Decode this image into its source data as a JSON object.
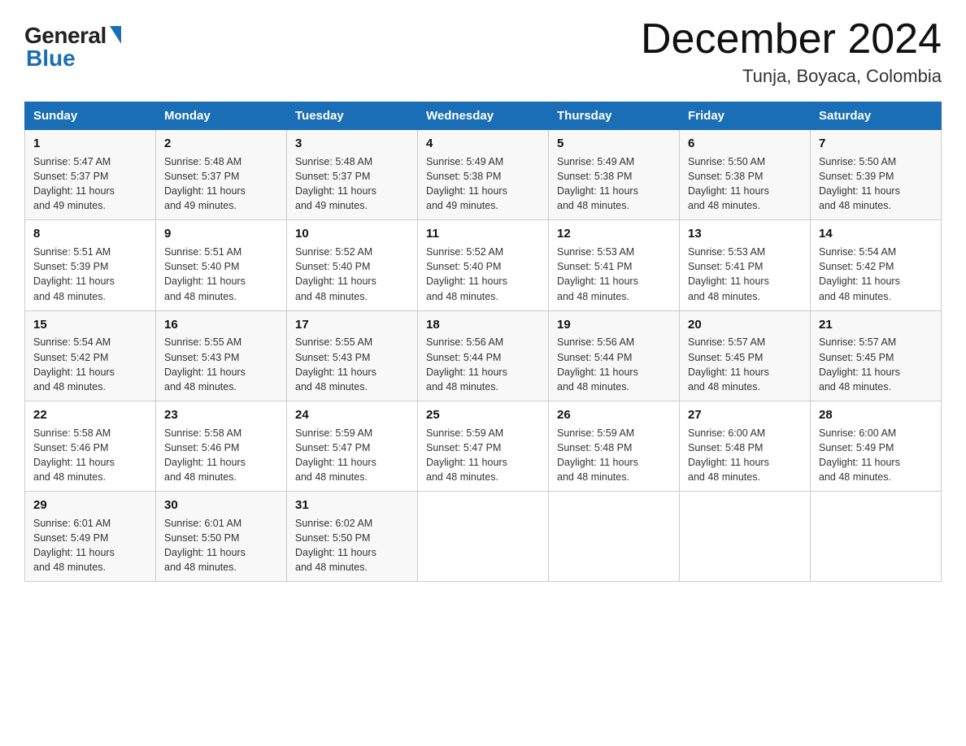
{
  "header": {
    "logo_general": "General",
    "logo_blue": "Blue",
    "month_year": "December 2024",
    "location": "Tunja, Boyaca, Colombia"
  },
  "days_of_week": [
    "Sunday",
    "Monday",
    "Tuesday",
    "Wednesday",
    "Thursday",
    "Friday",
    "Saturday"
  ],
  "weeks": [
    [
      {
        "day": "1",
        "info": "Sunrise: 5:47 AM\nSunset: 5:37 PM\nDaylight: 11 hours\nand 49 minutes."
      },
      {
        "day": "2",
        "info": "Sunrise: 5:48 AM\nSunset: 5:37 PM\nDaylight: 11 hours\nand 49 minutes."
      },
      {
        "day": "3",
        "info": "Sunrise: 5:48 AM\nSunset: 5:37 PM\nDaylight: 11 hours\nand 49 minutes."
      },
      {
        "day": "4",
        "info": "Sunrise: 5:49 AM\nSunset: 5:38 PM\nDaylight: 11 hours\nand 49 minutes."
      },
      {
        "day": "5",
        "info": "Sunrise: 5:49 AM\nSunset: 5:38 PM\nDaylight: 11 hours\nand 48 minutes."
      },
      {
        "day": "6",
        "info": "Sunrise: 5:50 AM\nSunset: 5:38 PM\nDaylight: 11 hours\nand 48 minutes."
      },
      {
        "day": "7",
        "info": "Sunrise: 5:50 AM\nSunset: 5:39 PM\nDaylight: 11 hours\nand 48 minutes."
      }
    ],
    [
      {
        "day": "8",
        "info": "Sunrise: 5:51 AM\nSunset: 5:39 PM\nDaylight: 11 hours\nand 48 minutes."
      },
      {
        "day": "9",
        "info": "Sunrise: 5:51 AM\nSunset: 5:40 PM\nDaylight: 11 hours\nand 48 minutes."
      },
      {
        "day": "10",
        "info": "Sunrise: 5:52 AM\nSunset: 5:40 PM\nDaylight: 11 hours\nand 48 minutes."
      },
      {
        "day": "11",
        "info": "Sunrise: 5:52 AM\nSunset: 5:40 PM\nDaylight: 11 hours\nand 48 minutes."
      },
      {
        "day": "12",
        "info": "Sunrise: 5:53 AM\nSunset: 5:41 PM\nDaylight: 11 hours\nand 48 minutes."
      },
      {
        "day": "13",
        "info": "Sunrise: 5:53 AM\nSunset: 5:41 PM\nDaylight: 11 hours\nand 48 minutes."
      },
      {
        "day": "14",
        "info": "Sunrise: 5:54 AM\nSunset: 5:42 PM\nDaylight: 11 hours\nand 48 minutes."
      }
    ],
    [
      {
        "day": "15",
        "info": "Sunrise: 5:54 AM\nSunset: 5:42 PM\nDaylight: 11 hours\nand 48 minutes."
      },
      {
        "day": "16",
        "info": "Sunrise: 5:55 AM\nSunset: 5:43 PM\nDaylight: 11 hours\nand 48 minutes."
      },
      {
        "day": "17",
        "info": "Sunrise: 5:55 AM\nSunset: 5:43 PM\nDaylight: 11 hours\nand 48 minutes."
      },
      {
        "day": "18",
        "info": "Sunrise: 5:56 AM\nSunset: 5:44 PM\nDaylight: 11 hours\nand 48 minutes."
      },
      {
        "day": "19",
        "info": "Sunrise: 5:56 AM\nSunset: 5:44 PM\nDaylight: 11 hours\nand 48 minutes."
      },
      {
        "day": "20",
        "info": "Sunrise: 5:57 AM\nSunset: 5:45 PM\nDaylight: 11 hours\nand 48 minutes."
      },
      {
        "day": "21",
        "info": "Sunrise: 5:57 AM\nSunset: 5:45 PM\nDaylight: 11 hours\nand 48 minutes."
      }
    ],
    [
      {
        "day": "22",
        "info": "Sunrise: 5:58 AM\nSunset: 5:46 PM\nDaylight: 11 hours\nand 48 minutes."
      },
      {
        "day": "23",
        "info": "Sunrise: 5:58 AM\nSunset: 5:46 PM\nDaylight: 11 hours\nand 48 minutes."
      },
      {
        "day": "24",
        "info": "Sunrise: 5:59 AM\nSunset: 5:47 PM\nDaylight: 11 hours\nand 48 minutes."
      },
      {
        "day": "25",
        "info": "Sunrise: 5:59 AM\nSunset: 5:47 PM\nDaylight: 11 hours\nand 48 minutes."
      },
      {
        "day": "26",
        "info": "Sunrise: 5:59 AM\nSunset: 5:48 PM\nDaylight: 11 hours\nand 48 minutes."
      },
      {
        "day": "27",
        "info": "Sunrise: 6:00 AM\nSunset: 5:48 PM\nDaylight: 11 hours\nand 48 minutes."
      },
      {
        "day": "28",
        "info": "Sunrise: 6:00 AM\nSunset: 5:49 PM\nDaylight: 11 hours\nand 48 minutes."
      }
    ],
    [
      {
        "day": "29",
        "info": "Sunrise: 6:01 AM\nSunset: 5:49 PM\nDaylight: 11 hours\nand 48 minutes."
      },
      {
        "day": "30",
        "info": "Sunrise: 6:01 AM\nSunset: 5:50 PM\nDaylight: 11 hours\nand 48 minutes."
      },
      {
        "day": "31",
        "info": "Sunrise: 6:02 AM\nSunset: 5:50 PM\nDaylight: 11 hours\nand 48 minutes."
      },
      null,
      null,
      null,
      null
    ]
  ]
}
